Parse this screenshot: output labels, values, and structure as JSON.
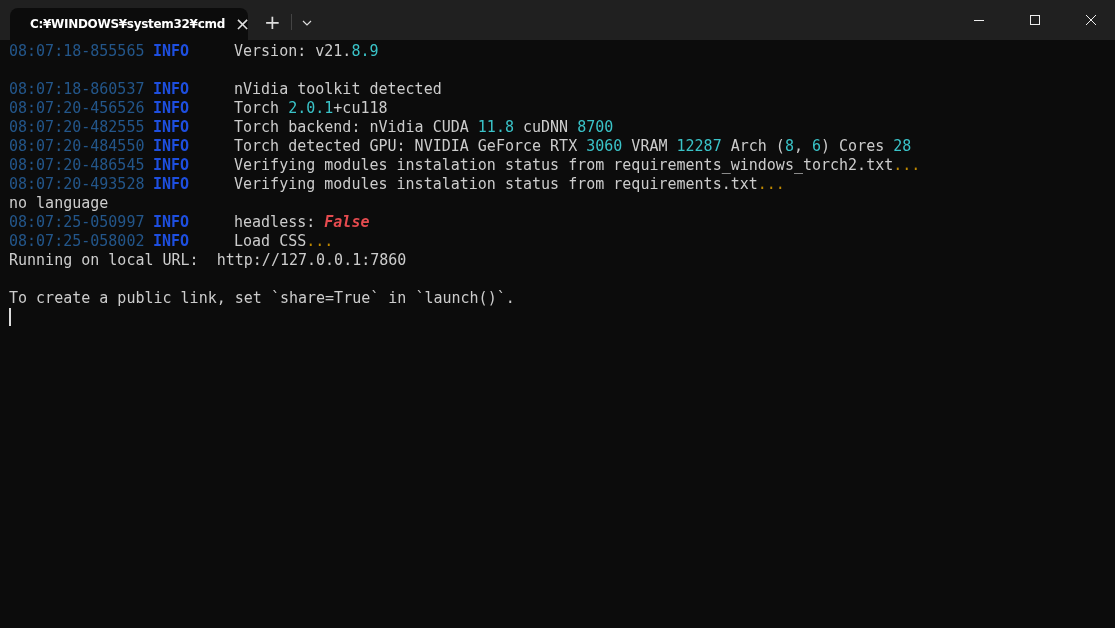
{
  "tab": {
    "title": "C:¥WINDOWS¥system32¥cmd",
    "close": "×",
    "selected": true
  },
  "new_tab": "+",
  "lines": [
    {
      "kind": "log",
      "time": "08:07:18-855565",
      "level": "INFO",
      "message": [
        {
          "text": "Version: v21.",
          "kind": "text"
        },
        {
          "text": "8.9",
          "kind": "number"
        }
      ]
    },
    {
      "kind": "blank"
    },
    {
      "kind": "log",
      "time": "08:07:18-860537",
      "level": "INFO",
      "message": [
        {
          "text": "nVidia toolkit detected",
          "kind": "text"
        }
      ]
    },
    {
      "kind": "log",
      "time": "08:07:20-456526",
      "level": "INFO",
      "message": [
        {
          "text": "Torch ",
          "kind": "text"
        },
        {
          "text": "2.0.1",
          "kind": "number"
        },
        {
          "text": "+cu118",
          "kind": "text"
        }
      ]
    },
    {
      "kind": "log",
      "time": "08:07:20-482555",
      "level": "INFO",
      "message": [
        {
          "text": "Torch backend: nVidia CUDA ",
          "kind": "text"
        },
        {
          "text": "11.8",
          "kind": "number"
        },
        {
          "text": " cuDNN ",
          "kind": "text"
        },
        {
          "text": "8700",
          "kind": "number"
        }
      ]
    },
    {
      "kind": "log",
      "time": "08:07:20-484550",
      "level": "INFO",
      "message": [
        {
          "text": "Torch detected GPU: NVIDIA GeForce RTX ",
          "kind": "text"
        },
        {
          "text": "3060",
          "kind": "number"
        },
        {
          "text": " VRAM ",
          "kind": "text"
        },
        {
          "text": "12287",
          "kind": "number"
        },
        {
          "text": " Arch (",
          "kind": "text"
        },
        {
          "text": "8",
          "kind": "number"
        },
        {
          "text": ", ",
          "kind": "text"
        },
        {
          "text": "6",
          "kind": "number"
        },
        {
          "text": ") Cores ",
          "kind": "text"
        },
        {
          "text": "28",
          "kind": "number"
        }
      ]
    },
    {
      "kind": "log",
      "time": "08:07:20-486545",
      "level": "INFO",
      "message": [
        {
          "text": "Verifying modules instalation status from requirements_windows_torch2.txt",
          "kind": "text"
        },
        {
          "text": "...",
          "kind": "ellipsis"
        }
      ]
    },
    {
      "kind": "log",
      "time": "08:07:20-493528",
      "level": "INFO",
      "message": [
        {
          "text": "Verifying modules instalation status from requirements.txt",
          "kind": "text"
        },
        {
          "text": "...",
          "kind": "ellipsis"
        }
      ]
    },
    {
      "kind": "plain",
      "text": "no language"
    },
    {
      "kind": "log",
      "time": "08:07:25-050997",
      "level": "INFO",
      "message": [
        {
          "text": "headless: ",
          "kind": "text"
        },
        {
          "text": "False",
          "kind": "boolean"
        }
      ]
    },
    {
      "kind": "log",
      "time": "08:07:25-058002",
      "level": "INFO",
      "message": [
        {
          "text": "Load CSS",
          "kind": "text"
        },
        {
          "text": "...",
          "kind": "ellipsis"
        }
      ]
    },
    {
      "kind": "plain",
      "text": "Running on local URL:  http://127.0.0.1:7860"
    },
    {
      "kind": "blank"
    },
    {
      "kind": "plain",
      "text": "To create a public link, set `share=True` in `launch()`."
    },
    {
      "kind": "cursor"
    }
  ]
}
